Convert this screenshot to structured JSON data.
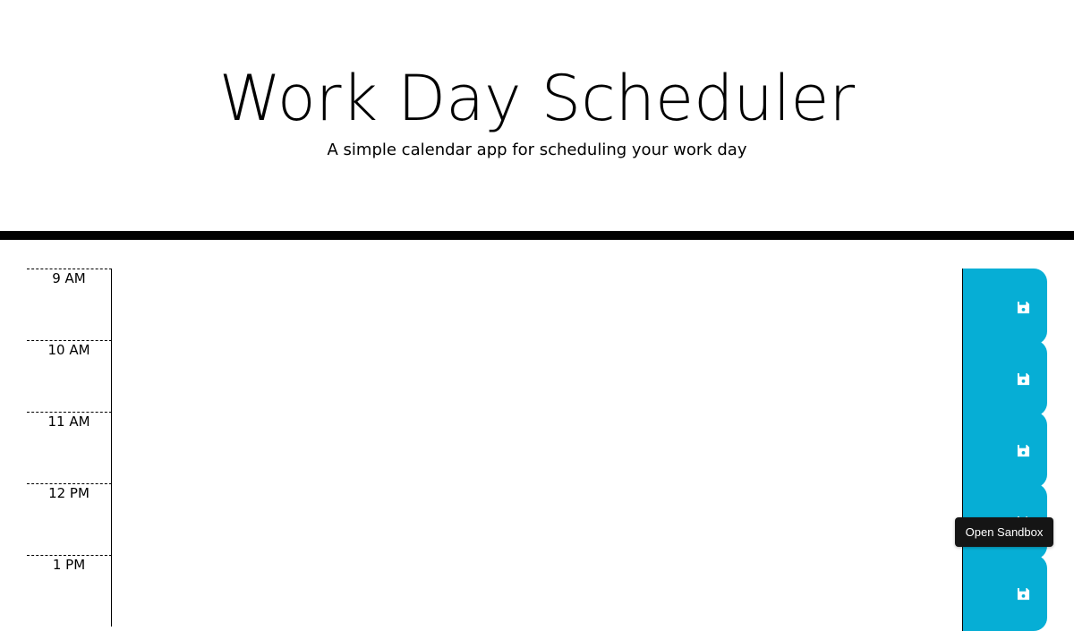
{
  "header": {
    "title": "Work Day Scheduler",
    "subtitle": "A simple calendar app for scheduling your work day"
  },
  "timeblocks": [
    {
      "hour": "9 AM",
      "description": ""
    },
    {
      "hour": "10 AM",
      "description": ""
    },
    {
      "hour": "11 AM",
      "description": ""
    },
    {
      "hour": "12 PM",
      "description": ""
    },
    {
      "hour": "1 PM",
      "description": ""
    }
  ],
  "save_icon": "floppy-disk-icon",
  "colors": {
    "save_button": "#06aed5",
    "divider": "#000000",
    "tooltip_bg": "#151515"
  },
  "tooltip": {
    "label": "Open Sandbox"
  }
}
